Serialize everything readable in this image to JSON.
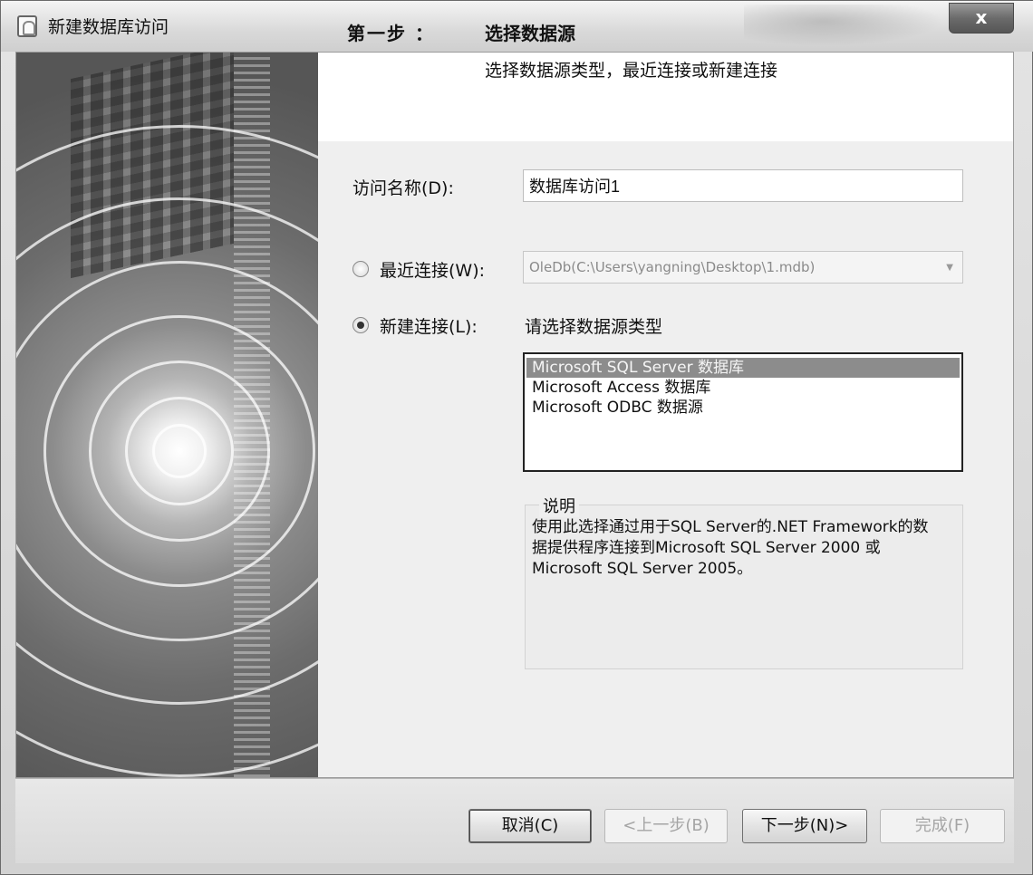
{
  "window": {
    "title": "新建数据库访问",
    "close_glyph": "x"
  },
  "header": {
    "step_label": "第一步 ：",
    "step_title": "选择数据源",
    "step_subtitle": "选择数据源类型，最近连接或新建连接"
  },
  "form": {
    "access_name_label": "访问名称(D):",
    "access_name_value": "数据库访问1",
    "recent_label": "最近连接(W):",
    "recent_value": "OleDb(C:\\Users\\yangning\\Desktop\\1.mdb)",
    "recent_checked": false,
    "new_label": "新建连接(L):",
    "new_checked": true,
    "datasource_prompt": "请选择数据源类型"
  },
  "datasource_list": {
    "items": [
      {
        "label": "Microsoft SQL Server 数据库",
        "selected": true
      },
      {
        "label": "Microsoft Access 数据库",
        "selected": false
      },
      {
        "label": "Microsoft ODBC 数据源",
        "selected": false
      }
    ]
  },
  "description": {
    "title": "说明",
    "text": "使用此选择通过用于SQL Server的.NET Framework的数据提供程序连接到Microsoft SQL Server 2000 或 Microsoft SQL Server 2005。"
  },
  "buttons": {
    "cancel": "取消(C)",
    "back": "<上一步(B)",
    "next": "下一步(N)>",
    "finish": "完成(F)"
  },
  "icons": [
    "app-icon",
    "close-icon",
    "dropdown-arrow-icon"
  ]
}
